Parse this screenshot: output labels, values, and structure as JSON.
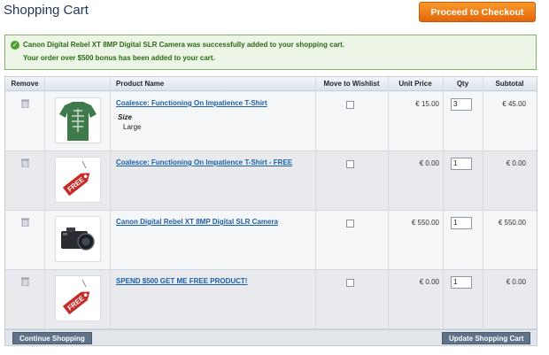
{
  "page": {
    "title": "Shopping Cart",
    "checkout_button": "Proceed to Checkout"
  },
  "messages": {
    "line1": "Canon Digital Rebel XT 8MP Digital SLR Camera was successfully added to your shopping cart.",
    "line2": "Your order over $500 bonus has been added to your cart."
  },
  "table": {
    "headers": {
      "remove": "Remove",
      "product_name": "Product Name",
      "wishlist": "Move to Wishlist",
      "unit_price": "Unit Price",
      "qty": "Qty",
      "subtotal": "Subtotal"
    },
    "rows": [
      {
        "name": "Coalesce: Functioning On Impatience T-Shirt",
        "attr_label": "Size",
        "attr_value": "Large",
        "unit_price": "€ 15.00",
        "qty": "3",
        "subtotal": "€ 45.00",
        "image": "tshirt-image"
      },
      {
        "name": "Coalesce: Functioning On Impatience T-Shirt - FREE",
        "unit_price": "€ 0.00",
        "qty": "1",
        "subtotal": "€ 0.00",
        "image": "free-tag-image"
      },
      {
        "name": "Canon Digital Rebel XT 8MP Digital SLR Camera",
        "unit_price": "€ 550.00",
        "qty": "1",
        "subtotal": "€ 550.00",
        "image": "camera-image"
      },
      {
        "name": "SPEND $500 GET ME FREE PRODUCT!",
        "unit_price": "€ 0.00",
        "qty": "1",
        "subtotal": "€ 0.00",
        "image": "free-tag-image"
      }
    ]
  },
  "footer": {
    "continue": "Continue Shopping",
    "update": "Update Shopping Cart"
  }
}
